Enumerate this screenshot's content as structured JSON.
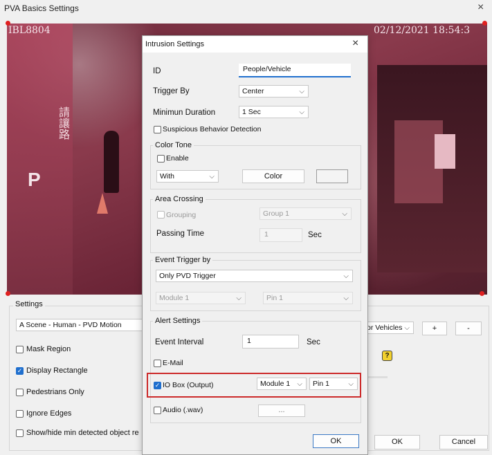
{
  "window": {
    "title": "PVA Basics Settings",
    "close": "×"
  },
  "video": {
    "camera_id": "IBL8804",
    "timestamp": "02/12/2021 18:54:3",
    "sign_text": "請讓路",
    "p_letter": "P"
  },
  "bg": {
    "settings_label": "Settings",
    "scene_value": "A Scene - Human - PVD Motion",
    "right_select": "or Vehicles",
    "plus": "+",
    "minus": "-",
    "help": "?",
    "mask_region": "Mask Region",
    "display_rectangle": "Display Rectangle",
    "pedestrians_only": "Pedestrians Only",
    "ignore_edges": "Ignore Edges",
    "show_hide": "Show/hide min detected object re",
    "ok": "OK",
    "cancel": "Cancel"
  },
  "dialog": {
    "title": "Intrusion Settings",
    "close": "×",
    "id_label": "ID",
    "id_value": "People/Vehicle",
    "trigger_by_label": "Trigger By",
    "trigger_by_value": "Center",
    "min_duration_label": "Minimun Duration",
    "min_duration_value": "1 Sec",
    "suspicious_label": "Suspicious Behavior Detection",
    "color_tone": {
      "title": "Color Tone",
      "enable": "Enable",
      "with_value": "With",
      "color_button": "Color"
    },
    "area_crossing": {
      "title": "Area Crossing",
      "grouping": "Grouping",
      "group_value": "Group 1",
      "passing_time": "Passing Time",
      "passing_value": "1",
      "sec": "Sec"
    },
    "event_trigger": {
      "title": "Event Trigger by",
      "value": "Only PVD Trigger",
      "module_value": "Module 1",
      "pin_value": "Pin 1"
    },
    "alert": {
      "title": "Alert Settings",
      "event_interval": "Event Interval",
      "event_interval_value": "1",
      "sec": "Sec",
      "email": "E-Mail",
      "io_box": "IO Box (Output)",
      "io_module": "Module 1",
      "io_pin": "Pin 1",
      "audio": "Audio (.wav)",
      "browse": "..."
    },
    "ok": "OK"
  },
  "colors": {
    "accent": "#1f6fce",
    "highlight": "#cc2a2a",
    "video_tint": "#8a3a4c"
  },
  "icons": [
    "close-icon",
    "chevron-down-icon",
    "checkmark-icon",
    "help-icon"
  ]
}
